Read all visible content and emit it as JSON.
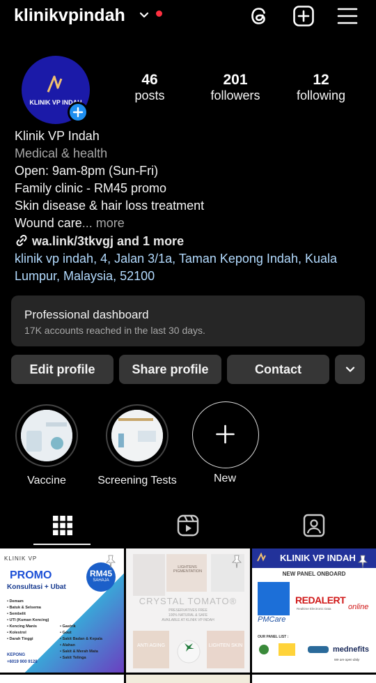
{
  "topbar": {
    "username": "klinikvpindah",
    "icons": [
      "threads-icon",
      "create-icon",
      "menu-icon"
    ],
    "notification_dot_color": "#ff3040"
  },
  "profile": {
    "avatar_text": "KLINIK VP INDAH",
    "stats": [
      {
        "count": "46",
        "label": "posts"
      },
      {
        "count": "201",
        "label": "followers"
      },
      {
        "count": "12",
        "label": "following"
      }
    ],
    "name": "Klinik VP Indah",
    "category": "Medical & health",
    "bio_lines": [
      "Open: 9am-8pm (Sun-Fri)",
      "Family clinic - RM45 promo",
      "Skin disease & hair loss treatment"
    ],
    "bio_truncated": "Wound care",
    "more": "... more",
    "link": "wa.link/3tkvgj and 1 more",
    "address_line1": "klinik vp indah, 4, Jalan 3/1a, Taman Kepong Indah, Kuala",
    "address_line2": "Lumpur, Malaysia, 52100"
  },
  "dashboard": {
    "title": "Professional dashboard",
    "subtitle": "17K accounts reached in the last 30 days."
  },
  "buttons": {
    "edit": "Edit profile",
    "share": "Share profile",
    "contact": "Contact"
  },
  "highlights": [
    {
      "label": "Vaccine"
    },
    {
      "label": "Screening Tests"
    },
    {
      "label": "New"
    }
  ],
  "posts": [
    {
      "brand": "KLINIK VP",
      "title": "PROMO",
      "subtitle": "Konsultasi + Ubat",
      "badge": "RM45",
      "badge_sub": "SAHAJA",
      "list_left": [
        "Demam",
        "Batuk & Selsema",
        "Sembelit",
        "UTI (Kuman Kencing)",
        "Kencing Manis",
        "Kolestrol",
        "Darah Tinggi"
      ],
      "list_right": [
        "Gastrik",
        "Gout",
        "Sakit Badan & Kepala",
        "Alahan",
        "Sakit & Merah Mata",
        "Sakit Telinga"
      ],
      "location": "KEPONG",
      "phone": "+6019 900 9128"
    },
    {
      "top_label": "LIGHTENS PIGMENTATION",
      "title": "CRYSTAL TOMATO®",
      "line1": "PRESERVATIVES FREE",
      "line2": "100% NATURAL & SAFE",
      "line3": "AVAILABLE AT KLINIK VP INDAH",
      "left_label": "ANTI AGING",
      "right_label": "LIGHTEN SKIN"
    },
    {
      "header": "KLINIK VP INDAH",
      "subheader": "NEW PANEL ONBOARD",
      "brand1": "REDALERT",
      "brand1_sub": "online",
      "brand1_tag": "Realtime Electronic Data",
      "pm": "PMCare",
      "panel_list": "OUR PANEL LIST :",
      "brand2": "mednefits",
      "open_text": "We are open daily"
    }
  ]
}
